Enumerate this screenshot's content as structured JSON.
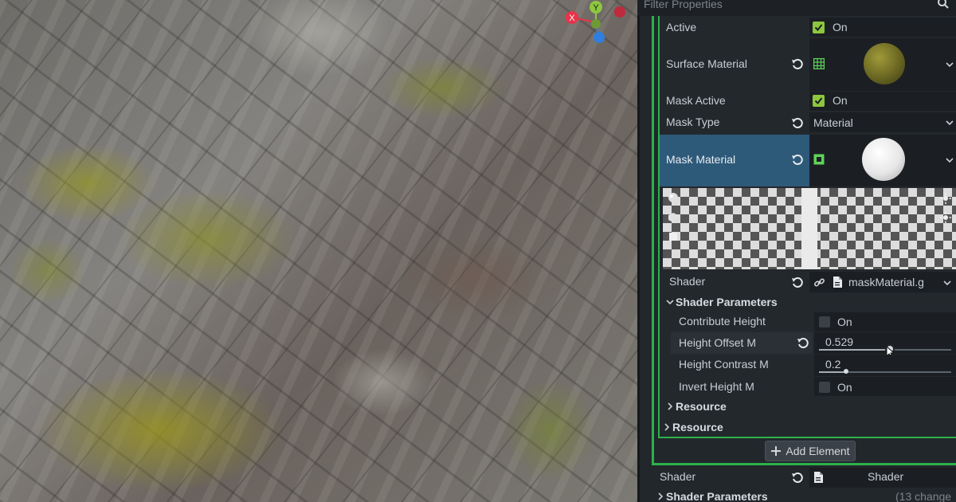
{
  "filter": {
    "placeholder": "Filter Properties",
    "search_icon": "search-icon"
  },
  "properties": {
    "active": {
      "label": "Active",
      "value": "On",
      "checked": true
    },
    "surface_material": {
      "label": "Surface Material"
    },
    "mask_active": {
      "label": "Mask Active",
      "value": "On",
      "checked": true
    },
    "mask_type": {
      "label": "Mask Type",
      "value": "Material"
    },
    "mask_material": {
      "label": "Mask Material"
    },
    "shader": {
      "label": "Shader",
      "value": "maskMaterial.g"
    },
    "shader_parameters": {
      "label": "Shader Parameters",
      "contribute_height": {
        "label": "Contribute Height",
        "value": "On",
        "checked": false
      },
      "height_offset": {
        "label": "Height Offset M",
        "value": "0.529"
      },
      "height_contrast": {
        "label": "Height Contrast M",
        "value": "0.2"
      },
      "invert_height": {
        "label": "Invert Height M",
        "value": "On",
        "checked": false
      }
    },
    "resource_inner": {
      "label": "Resource"
    },
    "resource_outer": {
      "label": "Resource"
    },
    "add_element": {
      "label": "Add Element"
    },
    "outer_shader": {
      "label": "Shader",
      "value": "Shader"
    },
    "outer_shader_parameters": {
      "label": "Shader Parameters",
      "changes": "(13 change"
    }
  },
  "gizmo": {
    "x": "X",
    "y": "Y"
  },
  "colors": {
    "accent_green": "#2bb24b",
    "selected_row": "#2e5a7a",
    "check": "#8dc73f",
    "gizmo_x": "#e8334a",
    "gizmo_y": "#8dc73f",
    "gizmo_z": "#2f7fe0"
  }
}
